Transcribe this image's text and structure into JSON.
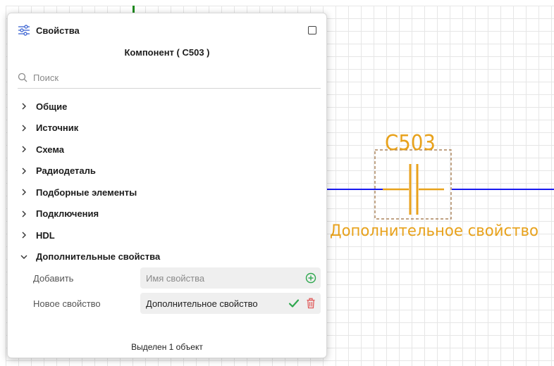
{
  "panel": {
    "title": "Свойства",
    "component_title": "Компонент ( C503 )",
    "search_placeholder": "Поиск",
    "groups": [
      {
        "label": "Общие",
        "expanded": false
      },
      {
        "label": "Источник",
        "expanded": false
      },
      {
        "label": "Схема",
        "expanded": false
      },
      {
        "label": "Радиодеталь",
        "expanded": false
      },
      {
        "label": "Подборные элементы",
        "expanded": false
      },
      {
        "label": "Подключения",
        "expanded": false
      },
      {
        "label": "HDL",
        "expanded": false
      },
      {
        "label": "Дополнительные свойства",
        "expanded": true
      }
    ],
    "add_row": {
      "label": "Добавить",
      "placeholder": "Имя свойства"
    },
    "prop_row": {
      "label": "Новое свойство",
      "value": "Дополнительное свойство"
    },
    "footer": "Выделен 1 объект"
  },
  "schematic": {
    "designator": "C503",
    "extra_property": "Дополнительное свойство",
    "wire_color": "#1a1af0",
    "symbol_color": "#e8a21c",
    "frame_color": "#9b6b3a"
  },
  "colors": {
    "accent_green": "#2fa84f",
    "delete_red": "#e05a5a",
    "arrow_teal": "#0f8a6e",
    "panel_icon": "#4a6fd6"
  }
}
